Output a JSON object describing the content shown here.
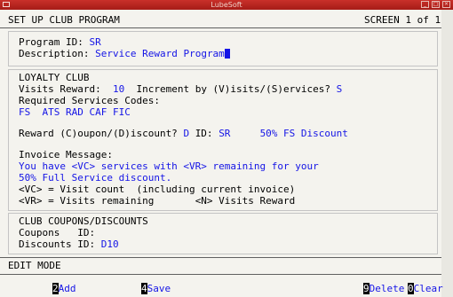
{
  "window": {
    "title": "LubeSoft"
  },
  "screen": {
    "title": "SET UP CLUB PROGRAM",
    "page": "SCREEN 1 of 1"
  },
  "program": {
    "id_label": "Program ID:",
    "id_value": "SR",
    "desc_label": "Description:",
    "desc_value": "Service Reward Program"
  },
  "loyalty": {
    "header": "LOYALTY CLUB",
    "visits_label": "Visits Reward:",
    "visits_value": "10",
    "increment_label": "Increment by (V)isits/(S)ervices?",
    "increment_value": "S",
    "req_label": "Required Services Codes:",
    "req_codes": "FS  ATS RAD CAF FIC",
    "reward_label": "Reward (C)oupon/(D)iscount?",
    "reward_value": "D",
    "reward_id_label": "ID:",
    "reward_id_value": "SR",
    "reward_desc": "50% FS Discount",
    "invoice_label": "Invoice Message:",
    "invoice_line1": "You have <VC> services with <VR> remaining for your",
    "invoice_line2": "50% Full Service discount.",
    "legend_line1": "<VC> = Visit count  (including current invoice)",
    "legend_line2a": "<VR> = Visits remaining",
    "legend_line2b": "<N> Visits Reward"
  },
  "coupons": {
    "header": "CLUB COUPONS/DISCOUNTS",
    "coupons_label": "Coupons   ID:",
    "coupons_value": "",
    "discounts_label": "Discounts ID:",
    "discounts_value": "D10"
  },
  "mode": "EDIT MODE",
  "fkeys": [
    {
      "num": "2",
      "label": "Add"
    },
    {
      "num": "4",
      "label": "Save"
    },
    {
      "num": "9",
      "label": "Delete"
    },
    {
      "num": "0",
      "label": "Clear"
    }
  ]
}
